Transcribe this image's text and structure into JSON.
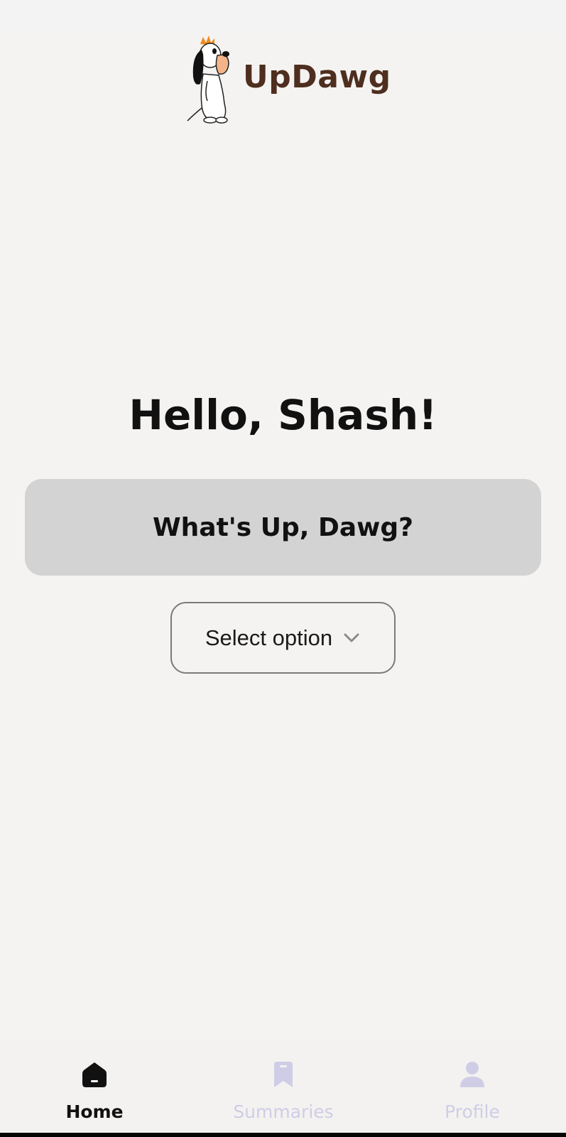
{
  "app": {
    "name": "UpDawg",
    "colors": {
      "brand": "#4e2e1f",
      "background": "#f4f3f1",
      "primary_button": "#d3d3d3",
      "nav_active": "#111111",
      "nav_inactive": "#cfcde6"
    }
  },
  "header": {
    "logo_text": "UpDawg",
    "logo_icon": "dog-mascot-icon"
  },
  "main": {
    "greeting": "Hello, Shash!",
    "primary_button_label": "What's Up, Dawg?",
    "select": {
      "placeholder": "Select option",
      "icon": "chevron-down-icon"
    }
  },
  "bottom_nav": {
    "items": [
      {
        "label": "Home",
        "icon": "home-icon",
        "active": true
      },
      {
        "label": "Summaries",
        "icon": "bookmark-icon",
        "active": false
      },
      {
        "label": "Profile",
        "icon": "person-icon",
        "active": false
      }
    ]
  }
}
